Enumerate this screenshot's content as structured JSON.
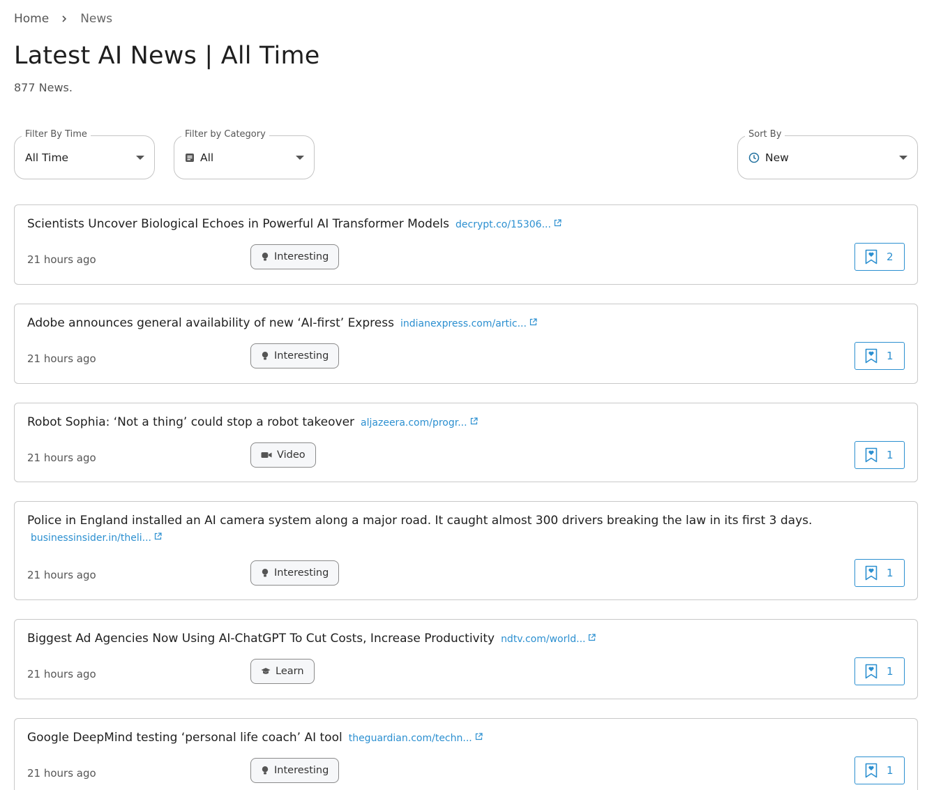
{
  "breadcrumb": {
    "home": "Home",
    "current": "News"
  },
  "page": {
    "title": "Latest AI News | All Time",
    "count": "877 News."
  },
  "filters": {
    "time": {
      "label": "Filter By Time",
      "value": "All Time"
    },
    "category": {
      "label": "Filter by Category",
      "value": "All"
    },
    "sort": {
      "label": "Sort By",
      "value": "New"
    }
  },
  "colors": {
    "link": "#2b8fd0",
    "border": "#c8c8c8",
    "text": "#1f1f1f"
  },
  "news": [
    {
      "title": "Scientists Uncover Biological Echoes in Powerful AI Transformer Models",
      "source": "decrypt.co/15306...",
      "time": "21 hours ago",
      "tag": "Interesting",
      "tag_icon": "lightbulb-icon",
      "bookmarks": "2"
    },
    {
      "title": "Adobe announces general availability of new ‘AI-first’ Express",
      "source": "indianexpress.com/artic...",
      "time": "21 hours ago",
      "tag": "Interesting",
      "tag_icon": "lightbulb-icon",
      "bookmarks": "1"
    },
    {
      "title": "Robot Sophia: ‘Not a thing’ could stop a robot takeover",
      "source": "aljazeera.com/progr...",
      "time": "21 hours ago",
      "tag": "Video",
      "tag_icon": "video-camera-icon",
      "bookmarks": "1"
    },
    {
      "title": "Police in England installed an AI camera system along a major road. It caught almost 300 drivers breaking the law in its first 3 days.",
      "source": "businessinsider.in/theli...",
      "time": "21 hours ago",
      "tag": "Interesting",
      "tag_icon": "lightbulb-icon",
      "bookmarks": "1"
    },
    {
      "title": "Biggest Ad Agencies Now Using AI-ChatGPT To Cut Costs, Increase Productivity",
      "source": "ndtv.com/world...",
      "time": "21 hours ago",
      "tag": "Learn",
      "tag_icon": "graduation-cap-icon",
      "bookmarks": "1"
    },
    {
      "title": "Google DeepMind testing ‘personal life coach’ AI tool",
      "source": "theguardian.com/techn...",
      "time": "21 hours ago",
      "tag": "Interesting",
      "tag_icon": "lightbulb-icon",
      "bookmarks": "1"
    }
  ]
}
